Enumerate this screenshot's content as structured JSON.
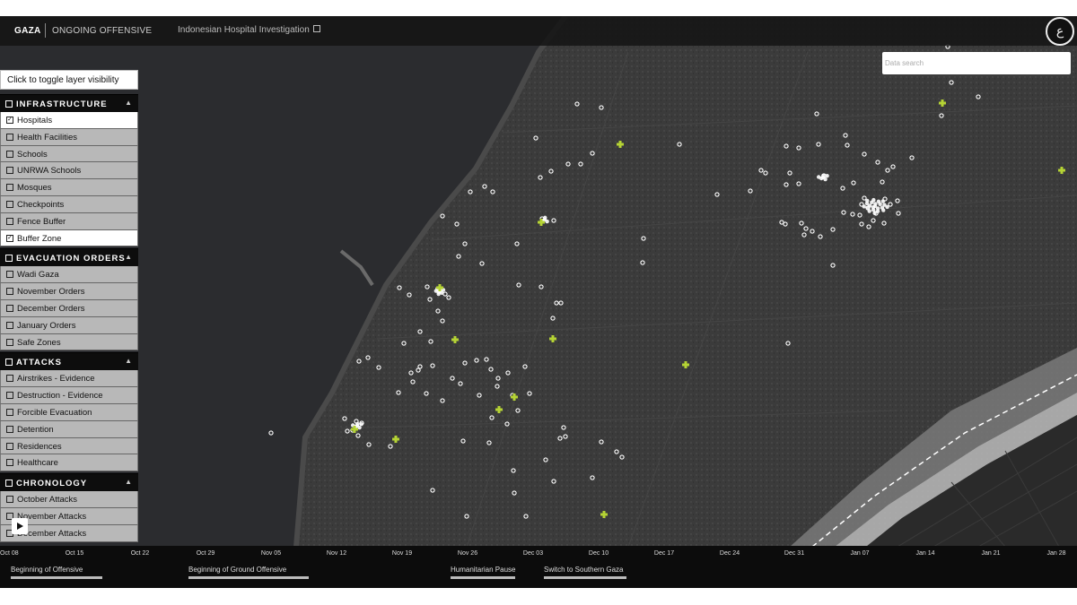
{
  "header": {
    "region": "GAZA",
    "subtitle": "ONGOING OFFENSIVE",
    "investigation_link": "Indonesian Hospital Investigation",
    "logo_glyph": "ع"
  },
  "search": {
    "placeholder": "Data search"
  },
  "sidebar": {
    "hint": "Click to toggle layer visibility",
    "groups": [
      {
        "title": "INFRASTRUCTURE",
        "items": [
          {
            "label": "Hospitals",
            "checked": true
          },
          {
            "label": "Health Facilities",
            "checked": false
          },
          {
            "label": "Schools",
            "checked": false
          },
          {
            "label": "UNRWA Schools",
            "checked": false
          },
          {
            "label": "Mosques",
            "checked": false
          },
          {
            "label": "Checkpoints",
            "checked": false
          },
          {
            "label": "Fence Buffer",
            "checked": false
          },
          {
            "label": "Buffer Zone",
            "checked": true
          }
        ]
      },
      {
        "title": "EVACUATION ORDERS",
        "items": [
          {
            "label": "Wadi Gaza",
            "checked": false
          },
          {
            "label": "November Orders",
            "checked": false
          },
          {
            "label": "December Orders",
            "checked": false
          },
          {
            "label": "January Orders",
            "checked": false
          },
          {
            "label": "Safe Zones",
            "checked": false
          }
        ]
      },
      {
        "title": "ATTACKS",
        "items": [
          {
            "label": "Airstrikes - Evidence",
            "checked": false
          },
          {
            "label": "Destruction - Evidence",
            "checked": false
          },
          {
            "label": "Forcible Evacuation",
            "checked": false
          },
          {
            "label": "Detention",
            "checked": false
          },
          {
            "label": "Residences",
            "checked": false
          },
          {
            "label": "Healthcare",
            "checked": false
          }
        ]
      },
      {
        "title": "CHRONOLOGY",
        "items": [
          {
            "label": "October Attacks",
            "checked": false
          },
          {
            "label": "November Attacks",
            "checked": false
          },
          {
            "label": "December Attacks",
            "checked": false
          }
        ]
      }
    ]
  },
  "timeline": {
    "dates": [
      "Oct 08",
      "Oct 15",
      "Oct 22",
      "Oct 29",
      "Nov 05",
      "Nov 12",
      "Nov 19",
      "Nov 26",
      "Dec 03",
      "Dec 10",
      "Dec 17",
      "Dec 24",
      "Dec 31",
      "Jan 07",
      "Jan 14",
      "Jan 21",
      "Jan 28"
    ],
    "events": [
      "Beginning of Offensive",
      "Beginning of Ground Offensive",
      "Humanitarian Pause",
      "Switch to Southern Gaza"
    ]
  },
  "colors": {
    "hospital_marker": "#b5d334",
    "incident_marker": "#ffffff",
    "sea": "#2b2c2f",
    "land": "#3a3a3a",
    "buffer_zone": "#8a8a8a"
  },
  "icons": [
    "play-icon",
    "hospital-cross-icon",
    "incident-marker-icon",
    "external-link-icon",
    "checkbox-icon",
    "caret-up-icon"
  ]
}
